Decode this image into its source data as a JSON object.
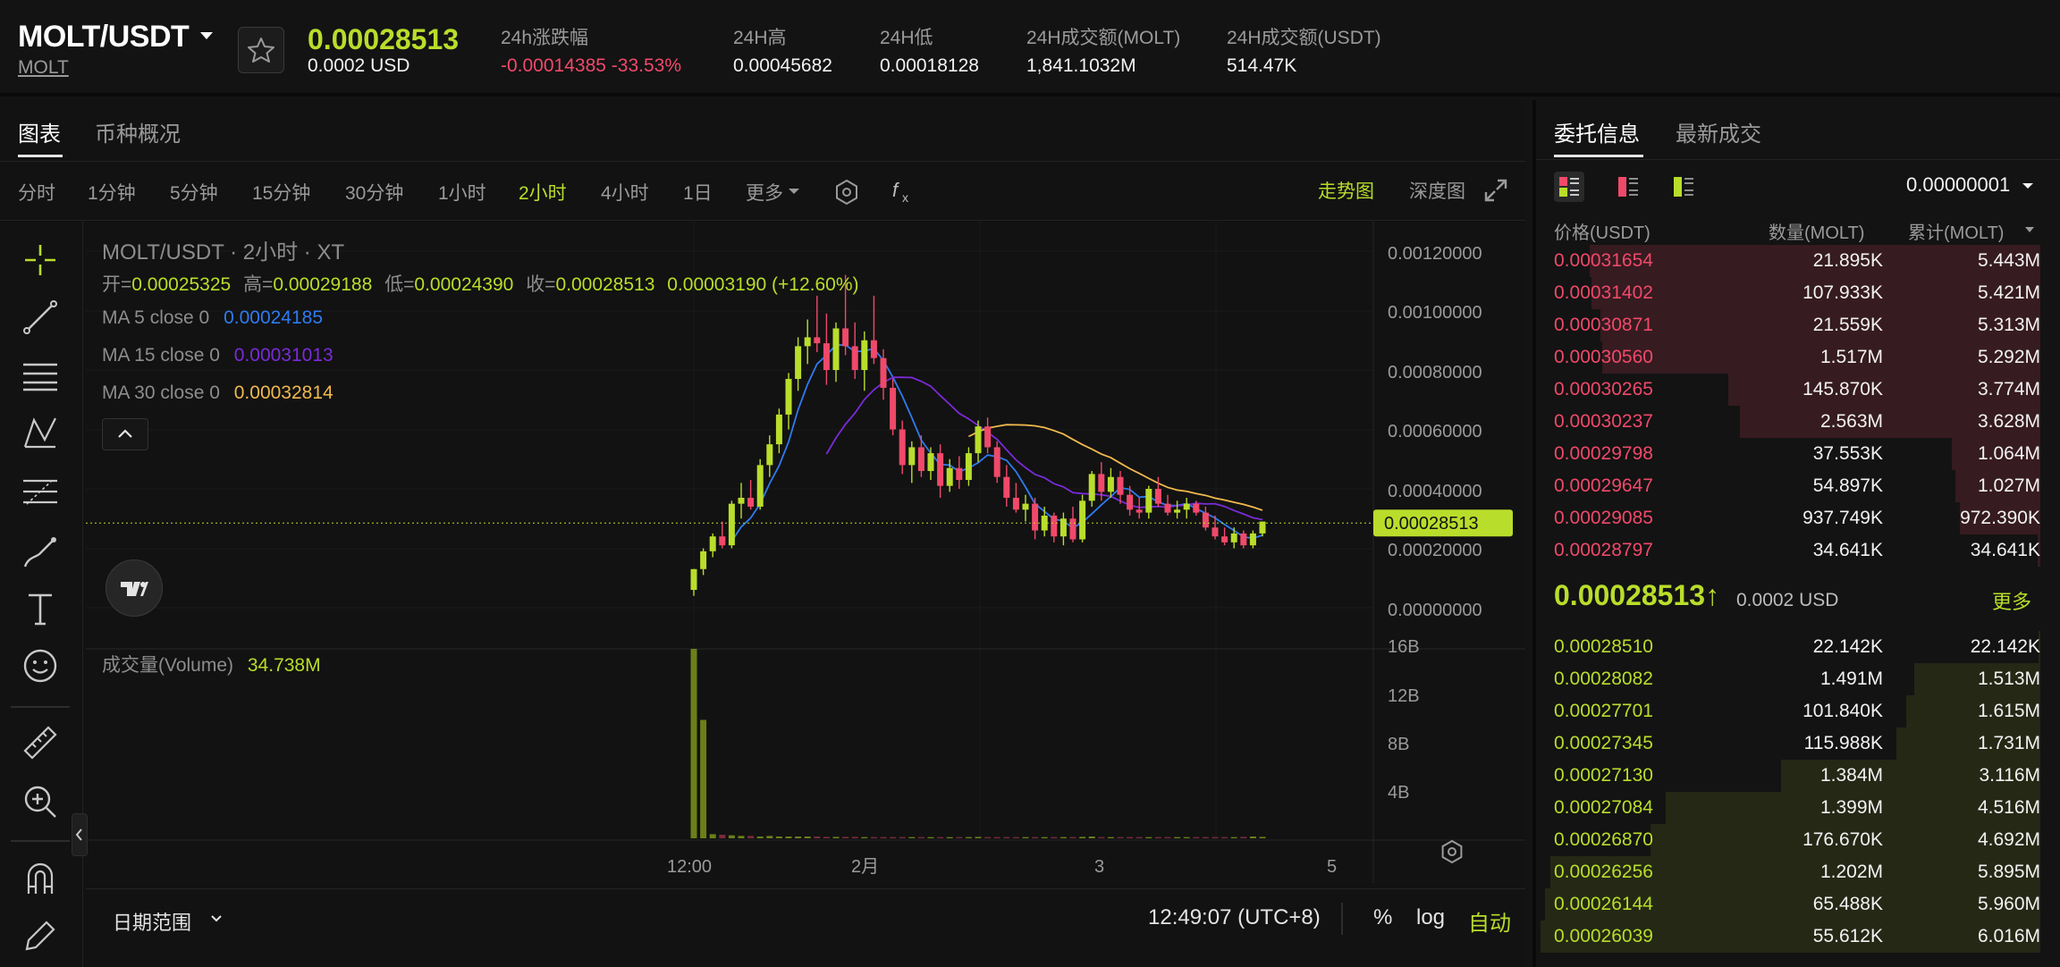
{
  "header": {
    "symbol": "MOLT/USDT",
    "base": "MOLT",
    "last_price": "0.00028513",
    "last_price_usd": "0.0002 USD",
    "stats": [
      {
        "label": "24h涨跌幅",
        "value": "-0.00014385 -33.53%"
      },
      {
        "label": "24H高",
        "value": "0.00045682"
      },
      {
        "label": "24H低",
        "value": "0.00018128"
      },
      {
        "label": "24H成交额(MOLT)",
        "value": "1,841.1032M"
      },
      {
        "label": "24H成交额(USDT)",
        "value": "514.47K"
      }
    ]
  },
  "chart_tabs": [
    "图表",
    "币种概况"
  ],
  "intervals": [
    "分时",
    "1分钟",
    "5分钟",
    "15分钟",
    "30分钟",
    "1小时",
    "2小时",
    "4小时",
    "1日",
    "更多"
  ],
  "active_interval": "2小时",
  "view_modes": {
    "trend": "走势图",
    "depth": "深度图"
  },
  "legend": {
    "title": "MOLT/USDT · 2小时 · XT",
    "ohlc": {
      "open_label": "开=",
      "open": "0.00025325",
      "high_label": "高=",
      "high": "0.00029188",
      "low_label": "低=",
      "low": "0.00024390",
      "close_label": "收=",
      "close": "0.00028513",
      "change": "0.00003190 (+12.60%)"
    },
    "ma": [
      {
        "label": "MA 5 close 0",
        "value": "0.00024185",
        "color": "#2f7bf0"
      },
      {
        "label": "MA 15 close 0",
        "value": "0.00031013",
        "color": "#7a2bd8"
      },
      {
        "label": "MA 30 close 0",
        "value": "0.00032814",
        "color": "#f0b94e"
      }
    ]
  },
  "price_axis": [
    "0.00120000",
    "0.00100000",
    "0.00080000",
    "0.00060000",
    "0.00040000",
    "0.00020000",
    "0.00000000"
  ],
  "current_price_tag": "0.00028513",
  "volume": {
    "label": "成交量(Volume)",
    "value": "34.738M",
    "axis": [
      "16B",
      "12B",
      "8B",
      "4B"
    ]
  },
  "time_axis": [
    "12:00",
    "2月",
    "3",
    "5"
  ],
  "bottom": {
    "date_range": "日期范围",
    "clock": "12:49:07 (UTC+8)",
    "percent": "%",
    "log": "log",
    "auto": "自动"
  },
  "orderbook": {
    "tabs": [
      "委托信息",
      "最新成交"
    ],
    "precision": "0.00000001",
    "headers": {
      "price": "价格(USDT)",
      "qty": "数量(MOLT)",
      "cum": "累计(MOLT)"
    },
    "asks": [
      {
        "price": "0.00031654",
        "qty": "21.895K",
        "cum": "5.443M",
        "depth": 0.9
      },
      {
        "price": "0.00031402",
        "qty": "107.933K",
        "cum": "5.421M",
        "depth": 0.897
      },
      {
        "price": "0.00030871",
        "qty": "21.559K",
        "cum": "5.313M",
        "depth": 0.879
      },
      {
        "price": "0.00030560",
        "qty": "1.517M",
        "cum": "5.292M",
        "depth": 0.875
      },
      {
        "price": "0.00030265",
        "qty": "145.870K",
        "cum": "3.774M",
        "depth": 0.624
      },
      {
        "price": "0.00030237",
        "qty": "2.563M",
        "cum": "3.628M",
        "depth": 0.6
      },
      {
        "price": "0.00029798",
        "qty": "37.553K",
        "cum": "1.064M",
        "depth": 0.176
      },
      {
        "price": "0.00029647",
        "qty": "54.897K",
        "cum": "1.027M",
        "depth": 0.17
      },
      {
        "price": "0.00029085",
        "qty": "937.749K",
        "cum": "972.390K",
        "depth": 0.161
      },
      {
        "price": "0.00028797",
        "qty": "34.641K",
        "cum": "34.641K",
        "depth": 0.006
      }
    ],
    "mid_price": "0.00028513↑",
    "mid_usd": "0.0002 USD",
    "more": "更多",
    "bids": [
      {
        "price": "0.00028510",
        "qty": "22.142K",
        "cum": "22.142K",
        "depth": 0.004
      },
      {
        "price": "0.00028082",
        "qty": "1.491M",
        "cum": "1.513M",
        "depth": 0.251
      },
      {
        "price": "0.00027701",
        "qty": "101.840K",
        "cum": "1.615M",
        "depth": 0.268
      },
      {
        "price": "0.00027345",
        "qty": "115.988K",
        "cum": "1.731M",
        "depth": 0.287
      },
      {
        "price": "0.00027130",
        "qty": "1.384M",
        "cum": "3.116M",
        "depth": 0.517
      },
      {
        "price": "0.00027084",
        "qty": "1.399M",
        "cum": "4.516M",
        "depth": 0.749
      },
      {
        "price": "0.00026870",
        "qty": "176.670K",
        "cum": "4.692M",
        "depth": 0.778
      },
      {
        "price": "0.00026256",
        "qty": "1.202M",
        "cum": "5.895M",
        "depth": 0.978
      },
      {
        "price": "0.00026144",
        "qty": "65.488K",
        "cum": "5.960M",
        "depth": 0.989
      },
      {
        "price": "0.00026039",
        "qty": "55.612K",
        "cum": "6.016M",
        "depth": 0.998
      }
    ]
  },
  "chart_data": {
    "type": "candlestick",
    "interval": "2小时",
    "ylim": [
      0,
      0.0012
    ],
    "candles": [
      [
        6e-05,
        0.00013,
        4e-05,
        0.00013
      ],
      [
        0.00013,
        0.0002,
        0.00011,
        0.00019
      ],
      [
        0.00019,
        0.00025,
        0.00017,
        0.00024
      ],
      [
        0.00024,
        0.00029,
        0.0002,
        0.00021
      ],
      [
        0.00021,
        0.00036,
        0.0002,
        0.00035
      ],
      [
        0.00035,
        0.00042,
        0.0003,
        0.00037
      ],
      [
        0.00037,
        0.00043,
        0.00033,
        0.00034
      ],
      [
        0.00034,
        0.0005,
        0.00033,
        0.00048
      ],
      [
        0.00048,
        0.00058,
        0.00044,
        0.00055
      ],
      [
        0.00055,
        0.00067,
        0.00052,
        0.00065
      ],
      [
        0.00065,
        0.00079,
        0.0006,
        0.00077
      ],
      [
        0.00077,
        0.00091,
        0.00073,
        0.00088
      ],
      [
        0.00088,
        0.00097,
        0.00082,
        0.00091
      ],
      [
        0.00091,
        0.00105,
        0.00086,
        0.00089
      ],
      [
        0.00089,
        0.00099,
        0.00075,
        0.0008
      ],
      [
        0.0008,
        0.00096,
        0.00076,
        0.00094
      ],
      [
        0.00094,
        0.00112,
        0.00085,
        0.00088
      ],
      [
        0.00088,
        0.00096,
        0.00077,
        0.0008
      ],
      [
        0.0008,
        0.00093,
        0.00073,
        0.0009
      ],
      [
        0.0009,
        0.00105,
        0.00082,
        0.00084
      ],
      [
        0.00084,
        0.00087,
        0.0007,
        0.00074
      ],
      [
        0.00074,
        0.00077,
        0.00058,
        0.0006
      ],
      [
        0.0006,
        0.00063,
        0.00045,
        0.00048
      ],
      [
        0.00048,
        0.00056,
        0.00042,
        0.00054
      ],
      [
        0.00054,
        0.00058,
        0.00044,
        0.00046
      ],
      [
        0.00046,
        0.00054,
        0.00043,
        0.00052
      ],
      [
        0.00052,
        0.00055,
        0.00037,
        0.00041
      ],
      [
        0.00041,
        0.0005,
        0.00039,
        0.00047
      ],
      [
        0.00047,
        0.00051,
        0.0004,
        0.00043
      ],
      [
        0.00043,
        0.00054,
        0.00041,
        0.00052
      ],
      [
        0.00052,
        0.00063,
        0.00049,
        0.00061
      ],
      [
        0.00061,
        0.00064,
        0.00052,
        0.00054
      ],
      [
        0.00054,
        0.00056,
        0.00042,
        0.00044
      ],
      [
        0.00044,
        0.00048,
        0.00034,
        0.00037
      ],
      [
        0.00037,
        0.00042,
        0.00032,
        0.00033
      ],
      [
        0.00033,
        0.00038,
        0.00029,
        0.00035
      ],
      [
        0.00035,
        0.00037,
        0.00023,
        0.00026
      ],
      [
        0.00026,
        0.00034,
        0.00024,
        0.00031
      ],
      [
        0.00031,
        0.00032,
        0.00022,
        0.00024
      ],
      [
        0.00024,
        0.00032,
        0.00021,
        0.0003
      ],
      [
        0.0003,
        0.00034,
        0.00022,
        0.00023
      ],
      [
        0.00023,
        0.00038,
        0.00022,
        0.00036
      ],
      [
        0.00036,
        0.00046,
        0.00034,
        0.00045
      ],
      [
        0.00045,
        0.00049,
        0.00036,
        0.00039
      ],
      [
        0.00039,
        0.00047,
        0.00037,
        0.00044
      ],
      [
        0.00044,
        0.00046,
        0.00035,
        0.00038
      ],
      [
        0.00038,
        0.00041,
        0.00031,
        0.00033
      ],
      [
        0.00033,
        0.00037,
        0.0003,
        0.00032
      ],
      [
        0.00032,
        0.00041,
        0.0003,
        0.0004
      ],
      [
        0.0004,
        0.00044,
        0.00034,
        0.00035
      ],
      [
        0.00035,
        0.00038,
        0.00031,
        0.00032
      ],
      [
        0.00032,
        0.00036,
        0.0003,
        0.00033
      ],
      [
        0.00033,
        0.00037,
        0.0003,
        0.00035
      ],
      [
        0.00035,
        0.00036,
        0.00031,
        0.00032
      ],
      [
        0.00032,
        0.00034,
        0.00026,
        0.00027
      ],
      [
        0.00027,
        0.00031,
        0.00023,
        0.00024
      ],
      [
        0.00024,
        0.00027,
        0.00021,
        0.00022
      ],
      [
        0.00022,
        0.00027,
        0.0002,
        0.00025
      ],
      [
        0.00025,
        0.00026,
        0.0002,
        0.00021
      ],
      [
        0.00021,
        0.00026,
        0.0002,
        0.00025
      ],
      [
        0.00025,
        0.00029,
        0.00024,
        0.00029
      ]
    ],
    "volume": [
      16.0,
      10.0,
      0.35,
      0.3,
      0.25,
      0.2,
      0.2,
      0.15,
      0.2,
      0.15,
      0.15,
      0.15,
      0.15,
      0.15,
      0.12,
      0.12,
      0.12,
      0.12,
      0.1,
      0.1,
      0.1,
      0.1,
      0.1,
      0.1,
      0.1,
      0.1,
      0.1,
      0.1,
      0.1,
      0.1,
      0.12,
      0.1,
      0.1,
      0.1,
      0.1,
      0.1,
      0.1,
      0.1,
      0.1,
      0.1,
      0.1,
      0.12,
      0.15,
      0.1,
      0.1,
      0.1,
      0.1,
      0.1,
      0.1,
      0.1,
      0.1,
      0.1,
      0.1,
      0.1,
      0.1,
      0.1,
      0.1,
      0.1,
      0.12,
      0.15,
      0.12
    ],
    "volume_ylim": [
      0,
      16
    ],
    "colors": {
      "up": "#b9dd2b",
      "down": "#f0496a"
    }
  }
}
